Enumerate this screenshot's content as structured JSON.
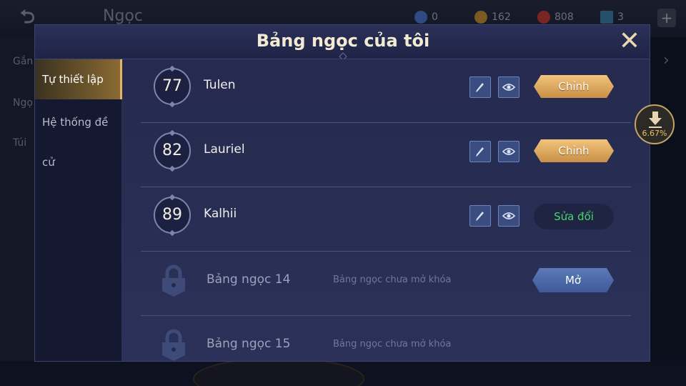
{
  "background": {
    "title": "Ngọc",
    "resources": [
      {
        "icon": "diamond-coupon-icon",
        "value": "0",
        "color": "#4a7fd6"
      },
      {
        "icon": "gold-coin-icon",
        "value": "162",
        "color": "#d08a2a"
      },
      {
        "icon": "red-gem-icon",
        "value": "808",
        "color": "#d03a3a"
      },
      {
        "icon": "blue-gem-icon",
        "value": "3",
        "color": "#4ab4e0"
      }
    ],
    "plus_label": "+",
    "left_items": [
      "Gắn",
      "Ngọ",
      "Túi"
    ]
  },
  "modal": {
    "title": "Bảng ngọc của tôi",
    "close_label": "✕"
  },
  "sidebar": {
    "items": [
      {
        "label": "Tự thiết lập",
        "active": true
      },
      {
        "label": "Hệ thống đề cử",
        "active": false
      }
    ]
  },
  "rows": [
    {
      "level": "77",
      "name": "Tulen",
      "action": "Chỉnh"
    },
    {
      "level": "82",
      "name": "Lauriel",
      "action": "Chỉnh"
    },
    {
      "level": "89",
      "name": "Kalhii",
      "action": "Sửa đổi"
    }
  ],
  "locked": [
    {
      "name": "Bảng ngọc 14",
      "desc": "Bảng ngọc chưa mở khóa",
      "action": "Mở"
    },
    {
      "name": "Bảng ngọc 15",
      "desc": "Bảng ngọc chưa mở khóa"
    }
  ],
  "download": {
    "percent": "6.67%"
  },
  "colors": {
    "accent_gold": "#e2b564",
    "edit_green": "#47d66c",
    "unlock_blue": "#4a68a8"
  }
}
